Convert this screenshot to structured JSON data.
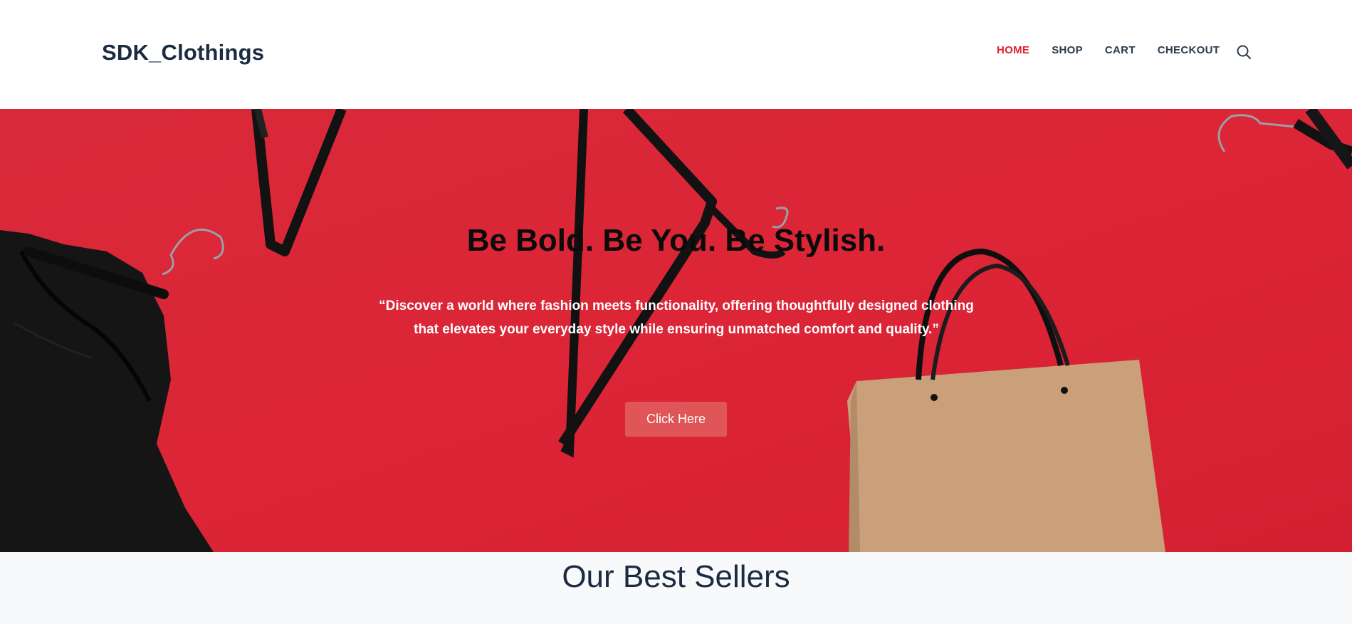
{
  "header": {
    "logo": "SDK_Clothings",
    "nav": [
      {
        "label": "HOME",
        "active": true
      },
      {
        "label": "SHOP",
        "active": false
      },
      {
        "label": "CART",
        "active": false
      },
      {
        "label": "CHECKOUT",
        "active": false
      }
    ],
    "search_icon": "search-icon"
  },
  "hero": {
    "title": "Be Bold. Be You. Be Stylish.",
    "subtitle_line1": "“Discover a world where fashion meets functionality, offering thoughtfully designed clothing",
    "subtitle_line2": "that elevates your everyday style while ensuring unmatched comfort and quality.”",
    "button_label": "Click Here"
  },
  "sections": {
    "best_sellers_title": "Our Best Sellers"
  },
  "colors": {
    "accent": "#e0202f",
    "hero_bg": "#da2536",
    "button": "#e05557"
  }
}
